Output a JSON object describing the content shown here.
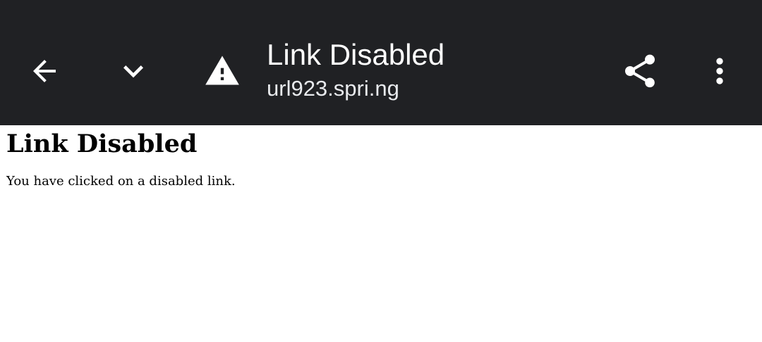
{
  "toolbar": {
    "title": "Link Disabled",
    "url": "url923.spri.ng",
    "background_color": "#202124",
    "icons": {
      "back": "arrow-back-icon",
      "expand": "chevron-down-icon",
      "security": "warning-icon",
      "share": "share-icon",
      "menu": "more-vert-icon"
    }
  },
  "page": {
    "heading": "Link Disabled",
    "message": "You have clicked on a disabled link."
  }
}
